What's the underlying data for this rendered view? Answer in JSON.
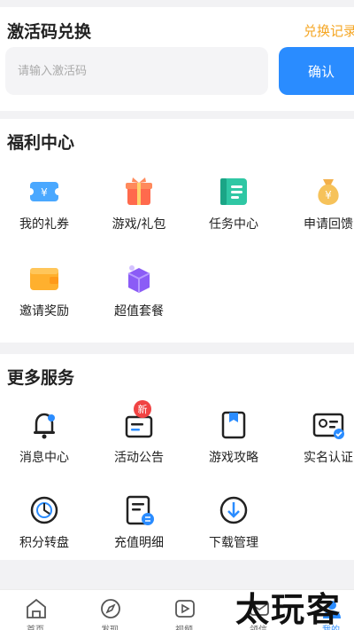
{
  "activation": {
    "title": "激活码兑换",
    "history_link": "兑换记录",
    "input_placeholder": "请输入激活码",
    "confirm_label": "确认"
  },
  "welfare": {
    "title": "福利中心",
    "items": [
      {
        "label": "我的礼券",
        "icon": "coupon-icon"
      },
      {
        "label": "游戏/礼包",
        "icon": "gift-icon"
      },
      {
        "label": "任务中心",
        "icon": "task-book-icon"
      },
      {
        "label": "申请回馈",
        "icon": "money-bag-icon"
      },
      {
        "label": "邀请奖励",
        "icon": "wallet-icon"
      },
      {
        "label": "超值套餐",
        "icon": "package-icon"
      }
    ]
  },
  "services": {
    "title": "更多服务",
    "new_badge": "新",
    "items": [
      {
        "label": "消息中心",
        "icon": "bell-icon"
      },
      {
        "label": "活动公告",
        "icon": "notice-icon"
      },
      {
        "label": "游戏攻略",
        "icon": "guide-icon"
      },
      {
        "label": "实名认证",
        "icon": "id-card-icon"
      },
      {
        "label": "积分转盘",
        "icon": "wheel-icon"
      },
      {
        "label": "充值明细",
        "icon": "recharge-detail-icon"
      },
      {
        "label": "下载管理",
        "icon": "download-icon"
      }
    ]
  },
  "tabbar": {
    "items": [
      {
        "label": "首页",
        "icon": "home-icon"
      },
      {
        "label": "发现",
        "icon": "compass-icon"
      },
      {
        "label": "视频",
        "icon": "video-icon"
      },
      {
        "label": "领信",
        "icon": "message-icon"
      },
      {
        "label": "我的",
        "icon": "profile-icon"
      }
    ],
    "active_index": 4
  },
  "watermark": "太玩客",
  "colors": {
    "accent": "#2a8cff",
    "link": "#f5a623",
    "badge": "#f04343"
  }
}
